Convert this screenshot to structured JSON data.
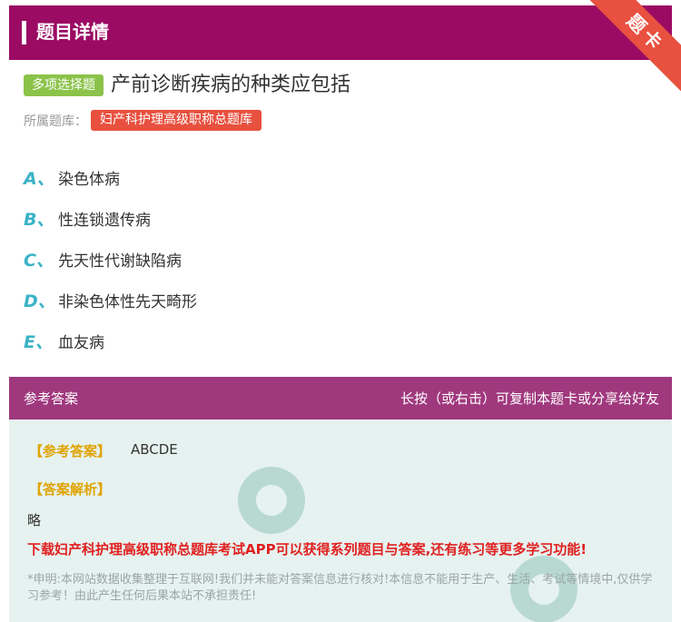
{
  "header": {
    "title": "题目详情",
    "corner_label": "题卡"
  },
  "question": {
    "type_badge": "多项选择题",
    "title": "产前诊断疾病的种类应包括",
    "bank_label": "所属题库：",
    "bank_name": "妇产科护理高级职称总题库"
  },
  "options": [
    {
      "letter": "A、",
      "text": "染色体病"
    },
    {
      "letter": "B、",
      "text": "性连锁遗传病"
    },
    {
      "letter": "C、",
      "text": "先天性代谢缺陷病"
    },
    {
      "letter": "D、",
      "text": "非染色体性先天畸形"
    },
    {
      "letter": "E、",
      "text": "血友病"
    }
  ],
  "answer_bar": {
    "left": "参考答案",
    "right": "长按（或右击）可复制本题卡或分享给好友"
  },
  "answer": {
    "ref_label": "【参考答案】",
    "ref_value": "ABCDE",
    "analysis_label": "【答案解析】",
    "analysis_value": "略",
    "promo": "下载妇产科护理高级职称总题库考试APP可以获得系列题目与答案,还有练习等更多学习功能!",
    "disclaimer": "*申明:本网站数据收集整理于互联网!我们并未能对答案信息进行核对!本信息不能用于生产、生活、考试等情境中,仅供学习参考！由此产生任何后果本站不承担责任!"
  },
  "colors": {
    "header": "#9b0a63",
    "answer_bar": "#a0387e",
    "accent": "#3ab3c6",
    "badge_type": "#8bc34a",
    "badge_bank": "#e8503f"
  }
}
